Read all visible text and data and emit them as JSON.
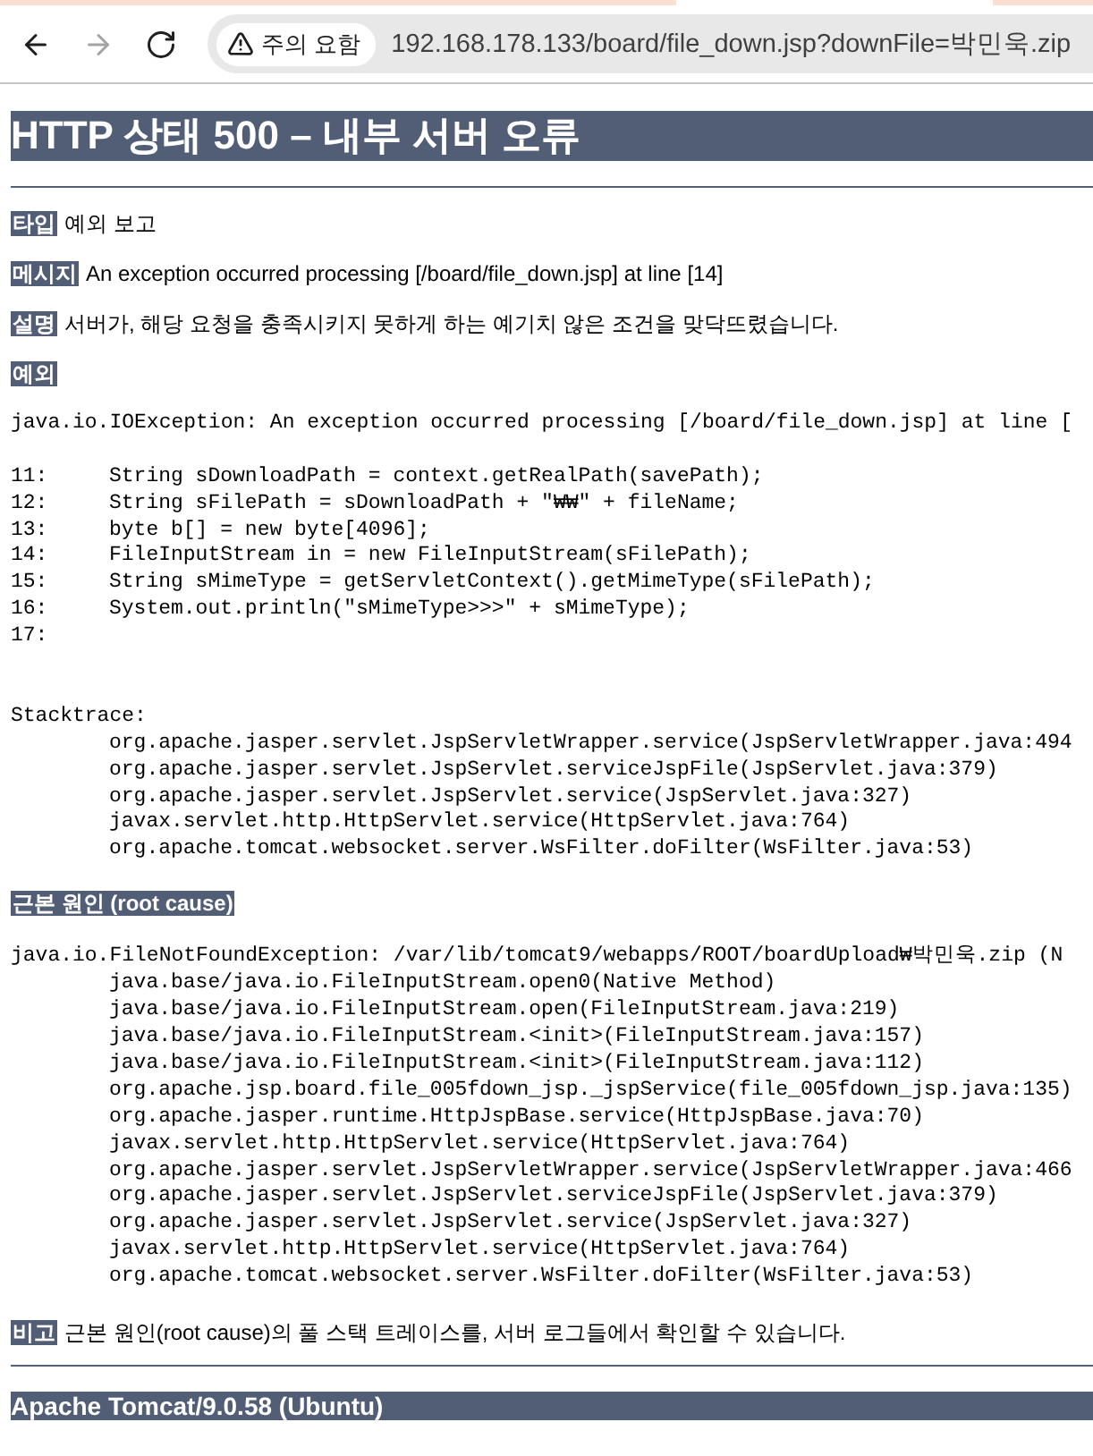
{
  "browser": {
    "nav_buttons": [
      {
        "kind": "back",
        "disabled": false
      },
      {
        "kind": "forward",
        "disabled": true
      },
      {
        "kind": "reload",
        "disabled": false
      }
    ],
    "security_chip": "주의 요함",
    "url": "192.168.178.133/board/file_down.jsp?downFile=박민욱.zip"
  },
  "page": {
    "title": "HTTP 상태 500 – 내부 서버 오류",
    "fields": [
      {
        "label": "타입",
        "value": "예외 보고"
      },
      {
        "label": "메시지",
        "value": "An exception occurred processing [/board/file_down.jsp] at line [14]"
      },
      {
        "label": "설명",
        "value": "서버가, 해당 요청을 충족시키지 못하게 하는 예기치 않은 조건을 맞닥뜨렸습니다."
      }
    ],
    "exception": {
      "label": "예외",
      "message": "java.io.IOException: An exception occurred processing [/board/file_down.jsp] at line [",
      "source_lines": [
        {
          "number": "11:",
          "code": "String sDownloadPath = context.getRealPath(savePath);"
        },
        {
          "number": "12:",
          "code": "String sFilePath = sDownloadPath + \"₩₩\" + fileName;"
        },
        {
          "number": "13:",
          "code": "byte b[] = new byte[4096];"
        },
        {
          "number": "14:",
          "code": "FileInputStream in = new FileInputStream(sFilePath);"
        },
        {
          "number": "15:",
          "code": "String sMimeType = getServletContext().getMimeType(sFilePath);"
        },
        {
          "number": "16:",
          "code": "System.out.println(\"sMimeType>>>\" + sMimeType);"
        },
        {
          "number": "17:"
        }
      ],
      "stacktrace_label": "Stacktrace:",
      "frames": [
        "org.apache.jasper.servlet.JspServletWrapper.service(JspServletWrapper.java:494",
        "org.apache.jasper.servlet.JspServlet.serviceJspFile(JspServlet.java:379)",
        "org.apache.jasper.servlet.JspServlet.service(JspServlet.java:327)",
        "javax.servlet.http.HttpServlet.service(HttpServlet.java:764)",
        "org.apache.tomcat.websocket.server.WsFilter.doFilter(WsFilter.java:53)"
      ]
    },
    "root_cause": {
      "label": "근본 원인 (root cause)",
      "message": "java.io.FileNotFoundException: /var/lib/tomcat9/webapps/ROOT/boardUpload₩박민욱.zip (N",
      "frames": [
        "java.base/java.io.FileInputStream.open0(Native Method)",
        "java.base/java.io.FileInputStream.open(FileInputStream.java:219)",
        "java.base/java.io.FileInputStream.<init>(FileInputStream.java:157)",
        "java.base/java.io.FileInputStream.<init>(FileInputStream.java:112)",
        "org.apache.jsp.board.file_005fdown_jsp._jspService(file_005fdown_jsp.java:135)",
        "org.apache.jasper.runtime.HttpJspBase.service(HttpJspBase.java:70)",
        "javax.servlet.http.HttpServlet.service(HttpServlet.java:764)",
        "org.apache.jasper.servlet.JspServletWrapper.service(JspServletWrapper.java:466",
        "org.apache.jasper.servlet.JspServlet.serviceJspFile(JspServlet.java:379)",
        "org.apache.jasper.servlet.JspServlet.service(JspServlet.java:327)",
        "javax.servlet.http.HttpServlet.service(HttpServlet.java:764)",
        "org.apache.tomcat.websocket.server.WsFilter.doFilter(WsFilter.java:53)"
      ]
    },
    "note": {
      "label": "비고",
      "value": "근본 원인(root cause)의 풀 스택 트레이스를, 서버 로그들에서 확인할 수 있습니다."
    },
    "footer": "Apache Tomcat/9.0.58 (Ubuntu)"
  }
}
